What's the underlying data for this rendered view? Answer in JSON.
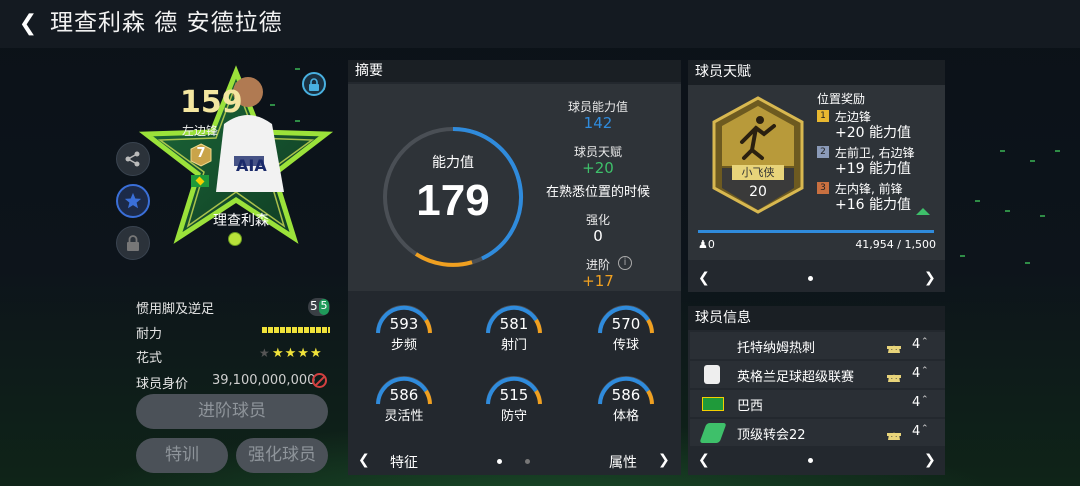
{
  "header": {
    "title": "理查利森 德 安德拉德"
  },
  "card": {
    "rating": "159",
    "position": "左边锋",
    "rank": "7",
    "name": "理查利森",
    "club_crest": "AIA"
  },
  "left_stats": {
    "foot_label": "惯用脚及逆足",
    "foot_value": "5",
    "foot_value2": "5",
    "stamina_label": "耐力",
    "skills_label": "花式",
    "skills_stars": "★★★★",
    "skills_empty": "★",
    "value_label": "球员身价",
    "value": "39,100,000,000"
  },
  "buttons": {
    "upgrade": "进阶球员",
    "train": "特训",
    "enhance": "强化球员"
  },
  "summary": {
    "title": "摘要",
    "ovr_label": "能力值",
    "ovr_value": "179",
    "base_label": "球员能力值",
    "base_value": "142",
    "talent_label": "球员天赋",
    "talent_value": "+20",
    "talent_note": "在熟悉位置的时候",
    "boost_label": "强化",
    "boost_value": "0",
    "advance_label": "进阶",
    "advance_value": "+17",
    "attributes": [
      {
        "value": "593",
        "label": "步频"
      },
      {
        "value": "581",
        "label": "射门"
      },
      {
        "value": "570",
        "label": "传球"
      },
      {
        "value": "586",
        "label": "灵活性"
      },
      {
        "value": "515",
        "label": "防守"
      },
      {
        "value": "586",
        "label": "体格"
      }
    ],
    "footer_left": "特征",
    "footer_right": "属性"
  },
  "talent": {
    "title": "球员天赋",
    "badge_name": "小飞侠",
    "badge_level": "20",
    "bonus_title": "位置奖励",
    "bonuses": [
      {
        "num": "1",
        "pos": "左边锋",
        "bonus": "+20 能力值"
      },
      {
        "num": "2",
        "pos": "左前卫, 右边锋",
        "bonus": "+19 能力值"
      },
      {
        "num": "3",
        "pos": "左内锋, 前锋",
        "bonus": "+16 能力值"
      }
    ],
    "progress_left": "0",
    "progress_right": "41,954 / 1,500"
  },
  "info": {
    "title": "球员信息",
    "rows": [
      {
        "text": "托特纳姆热刺",
        "num": "4"
      },
      {
        "text": "英格兰足球超级联赛",
        "num": "4"
      },
      {
        "text": "巴西",
        "num": "4"
      },
      {
        "text": "顶级转会22",
        "num": "4"
      }
    ]
  },
  "colors": {
    "accent_blue": "#2f8bdc",
    "accent_orange": "#f0a020",
    "talent_green": "#3ec06a",
    "gold": "#d8b850"
  }
}
